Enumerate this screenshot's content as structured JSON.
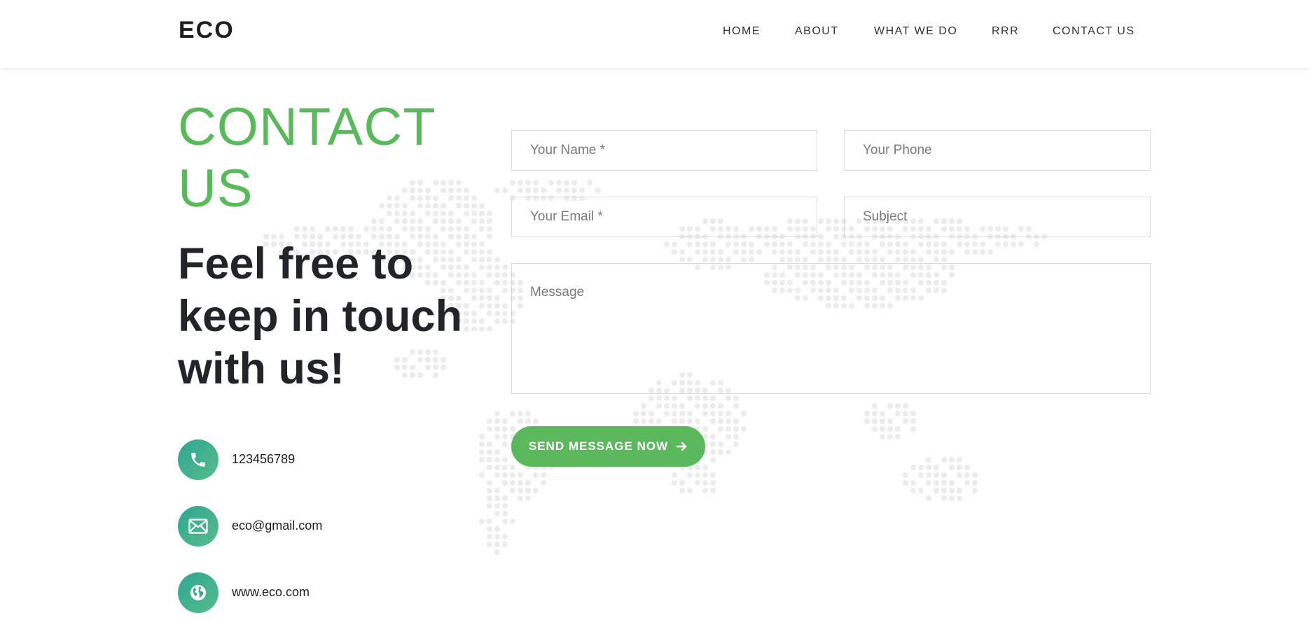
{
  "header": {
    "logo": "ECO",
    "nav": [
      {
        "label": "HOME"
      },
      {
        "label": "ABOUT"
      },
      {
        "label": "WHAT WE DO"
      },
      {
        "label": "RRR"
      },
      {
        "label": "CONTACT US"
      }
    ]
  },
  "left": {
    "title": "CONTACT US",
    "tagline": "Feel free to keep in touch with us!",
    "contacts": [
      {
        "icon": "phone-icon",
        "text": "123456789"
      },
      {
        "icon": "mail-icon",
        "text": "eco@gmail.com"
      },
      {
        "icon": "globe-icon",
        "text": "www.eco.com"
      }
    ]
  },
  "form": {
    "name_placeholder": "Your Name *",
    "phone_placeholder": "Your Phone",
    "email_placeholder": "Your Email *",
    "subject_placeholder": "Subject",
    "message_placeholder": "Message",
    "name_value": "",
    "phone_value": "",
    "email_value": "",
    "subject_value": "",
    "message_value": "",
    "submit_label": "SEND MESSAGE NOW"
  },
  "colors": {
    "accent": "#5cb85c",
    "icon_gradient_start": "#2fa592",
    "icon_gradient_end": "#56bd8a",
    "map_dot": "#ececec",
    "heading": "#22242a"
  }
}
